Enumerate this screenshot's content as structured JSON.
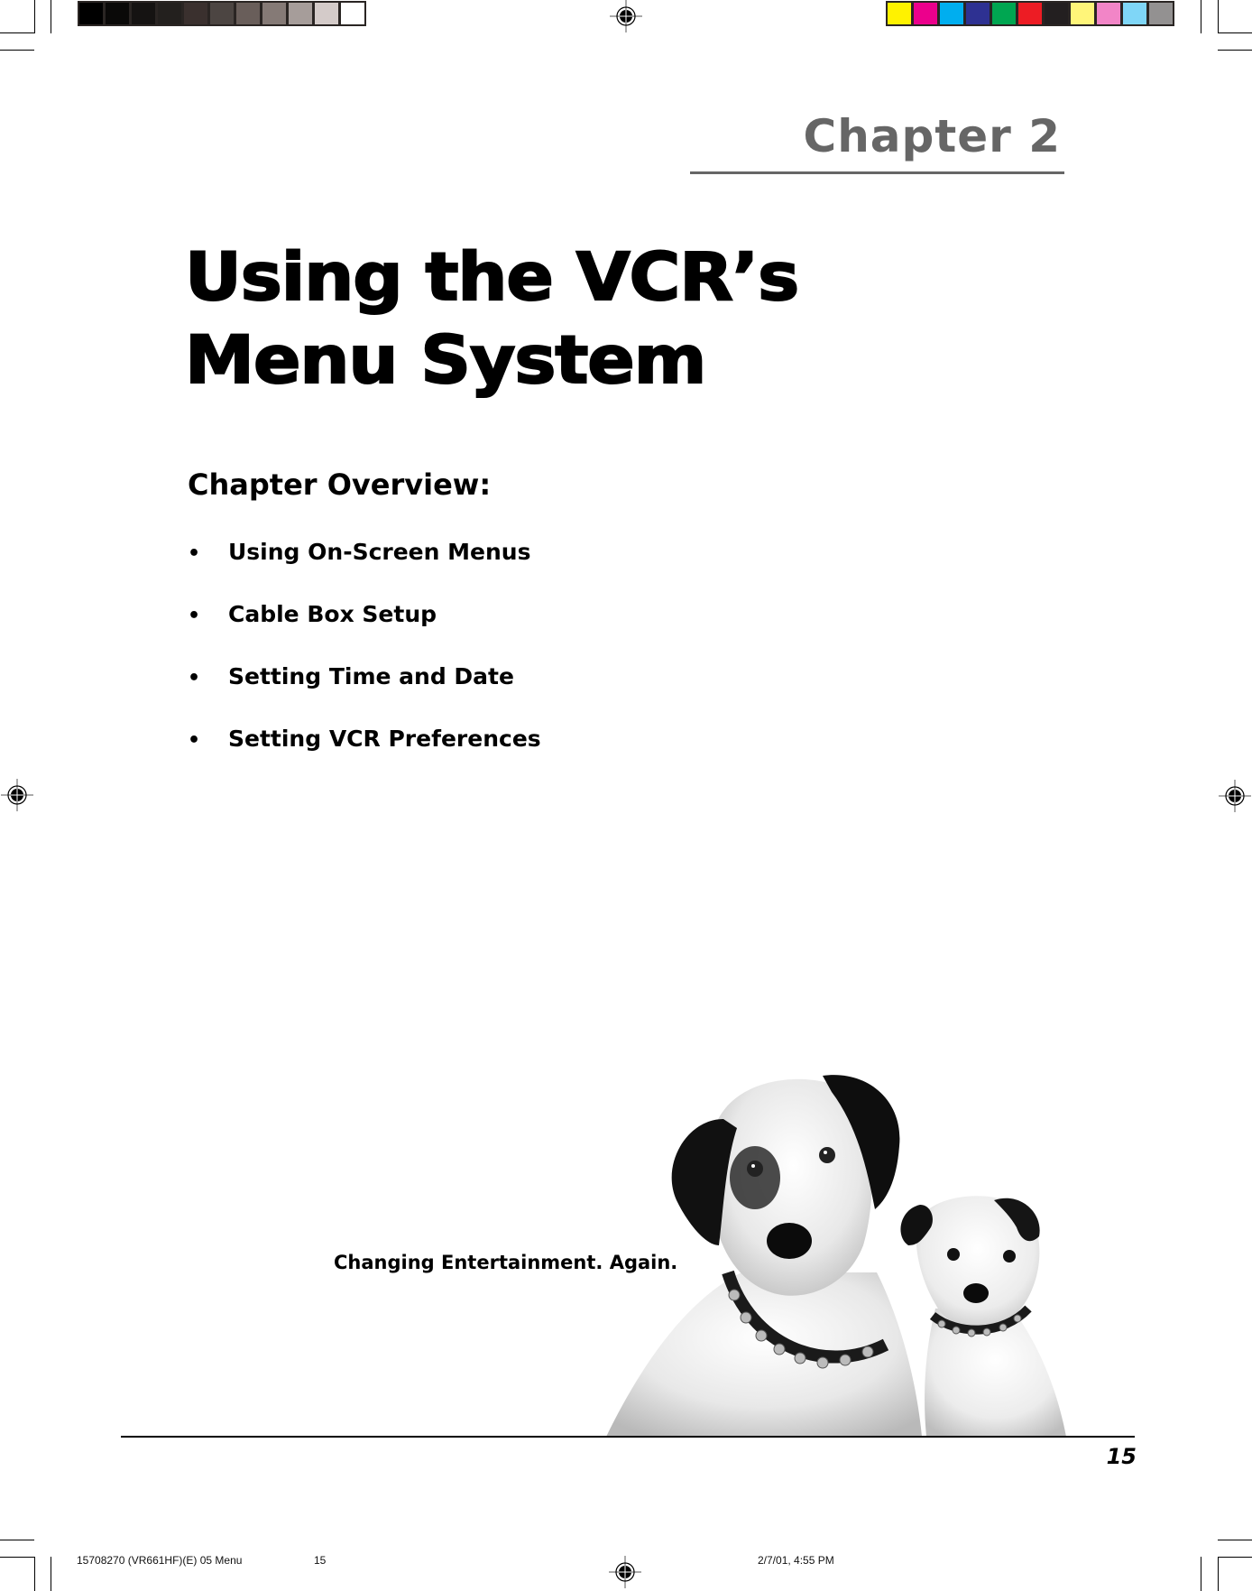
{
  "page": {
    "chapter_label": "Chapter 2",
    "title_line1": "Using the VCR’s",
    "title_line2": "Menu System",
    "overview_heading": "Chapter Overview:",
    "overview_items": [
      {
        "bullet": "•",
        "label": "Using On-Screen Menus"
      },
      {
        "bullet": "•",
        "label": "Cable Box Setup"
      },
      {
        "bullet": "•",
        "label": "Setting Time and Date"
      },
      {
        "bullet": "•",
        "label": "Setting VCR Preferences"
      }
    ],
    "tagline": "Changing Entertainment. Again.",
    "page_number": "15",
    "photo_description": "two-dogs-photo"
  },
  "print_marks": {
    "slug_file": "15708270 (VR661HF)(E) 05 Menu",
    "slug_page": "15",
    "slug_date": "2/7/01, 4:55 PM",
    "grayscale_swatches": [
      "#000000",
      "#0a0908",
      "#151312",
      "#23201e",
      "#3a302e",
      "#4c4542",
      "#695e5a",
      "#857a76",
      "#a69d9a",
      "#d4cbc9",
      "#ffffff"
    ],
    "color_swatches": [
      "#fff200",
      "#ec008c",
      "#00aeef",
      "#2e3192",
      "#00a651",
      "#ed1c24",
      "#231f20",
      "#fff579",
      "#f285c7",
      "#7fd6f7",
      "#939191"
    ]
  }
}
